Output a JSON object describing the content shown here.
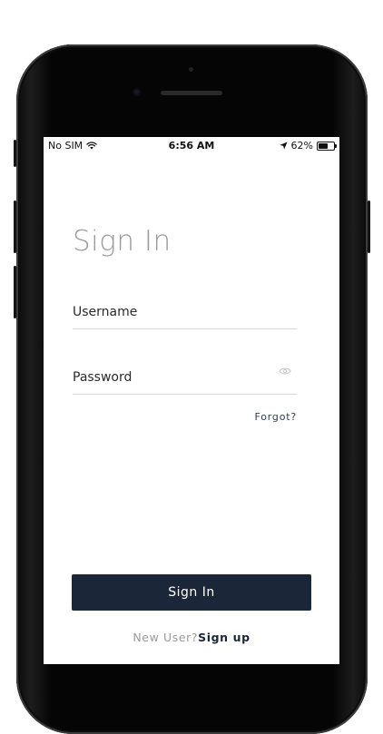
{
  "status_bar": {
    "carrier": "No SIM",
    "time": "6:56 AM",
    "battery_percent_label": "62%",
    "battery_level": 0.62
  },
  "page": {
    "title": "Sign In"
  },
  "form": {
    "username_placeholder": "Username",
    "password_placeholder": "Password",
    "forgot_label": "Forgot?",
    "submit_label": "Sign In"
  },
  "footer": {
    "prompt": "New User?",
    "signup_label": "Sign up"
  },
  "colors": {
    "primary": "#1b2638",
    "title_gray": "#9a9a9a",
    "divider": "#d8d8d8"
  },
  "icons": {
    "wifi": "wifi-icon",
    "location": "location-arrow-icon",
    "battery": "battery-icon",
    "password_toggle": "eye-icon"
  }
}
